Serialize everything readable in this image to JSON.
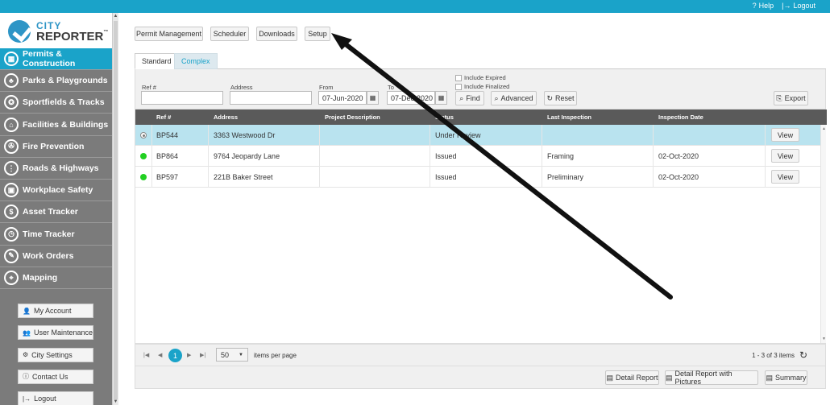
{
  "topbar": {
    "help": "Help",
    "logout": "Logout"
  },
  "logo": {
    "line1": "CITY",
    "line2": "REPORTER",
    "tm": "™"
  },
  "nav": [
    {
      "label": "Permits & Construction",
      "icon": "buildings-icon",
      "active": true
    },
    {
      "label": "Parks & Playgrounds",
      "icon": "tree-icon"
    },
    {
      "label": "Sportfields & Tracks",
      "icon": "trophy-icon"
    },
    {
      "label": "Facilities & Buildings",
      "icon": "house-icon"
    },
    {
      "label": "Fire Prevention",
      "icon": "fire-extinguisher-icon"
    },
    {
      "label": "Roads & Highways",
      "icon": "traffic-light-icon"
    },
    {
      "label": "Workplace Safety",
      "icon": "toolbox-icon"
    },
    {
      "label": "Asset Tracker",
      "icon": "dollar-hand-icon"
    },
    {
      "label": "Time Tracker",
      "icon": "clock-icon"
    },
    {
      "label": "Work Orders",
      "icon": "clipboard-icon"
    },
    {
      "label": "Mapping",
      "icon": "map-icon"
    }
  ],
  "sidebar_buttons": [
    {
      "label": "My Account",
      "icon": "user-icon",
      "glyph": "👤"
    },
    {
      "label": "User Maintenance",
      "icon": "users-icon",
      "glyph": "👥"
    },
    {
      "label": "City Settings",
      "icon": "gear-icon",
      "glyph": "⚙"
    },
    {
      "label": "Contact Us",
      "icon": "info-icon",
      "glyph": "ⓘ"
    },
    {
      "label": "Logout",
      "icon": "logout-icon",
      "glyph": "|→"
    }
  ],
  "toolbar": {
    "permit_management": "Permit Management",
    "scheduler": "Scheduler",
    "downloads": "Downloads",
    "setup": "Setup"
  },
  "tabs": {
    "standard": "Standard",
    "complex": "Complex"
  },
  "filter": {
    "ref_label": "Ref #",
    "address_label": "Address",
    "from_label": "From",
    "to_label": "To",
    "from_value": "07-Jun-2020",
    "to_value": "07-Dec-2020",
    "include_expired": "Include Expired",
    "include_finalized": "Include Finalized",
    "find": "Find",
    "advanced": "Advanced",
    "reset": "Reset",
    "export": "Export"
  },
  "columns": {
    "ref": "Ref #",
    "address": "Address",
    "project": "Project Description",
    "status": "Status",
    "last_inspection": "Last Inspection",
    "inspection_date": "Inspection Date"
  },
  "rows": [
    {
      "ref": "BP544",
      "address": "3363 Westwood Dr",
      "project": "",
      "status": "Under Review",
      "last_inspection": "",
      "inspection_date": "",
      "view": "View"
    },
    {
      "ref": "BP864",
      "address": "9764 Jeopardy Lane",
      "project": "",
      "status": "Issued",
      "last_inspection": "Framing",
      "inspection_date": "02-Oct-2020",
      "view": "View"
    },
    {
      "ref": "BP597",
      "address": "221B Baker Street",
      "project": "",
      "status": "Issued",
      "last_inspection": "Preliminary",
      "inspection_date": "02-Oct-2020",
      "view": "View"
    }
  ],
  "pager": {
    "current_page": "1",
    "page_size": "50",
    "items_per_page": "items per page",
    "count": "1 - 3 of 3 items"
  },
  "footer": {
    "detail_report": "Detail Report",
    "detail_report_pictures": "Detail Report with Pictures",
    "summary": "Summary"
  },
  "colors": {
    "accent": "#1aa3c9",
    "sidebar": "#7b7b7b",
    "active_dot": "#22d022",
    "selected_row": "#b9e3ef"
  }
}
